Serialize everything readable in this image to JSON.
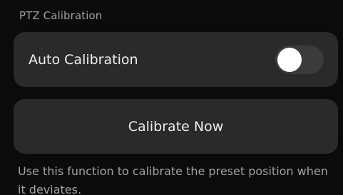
{
  "section": {
    "title": "PTZ Calibration"
  },
  "auto_calibration": {
    "label": "Auto Calibration",
    "enabled": false
  },
  "calibrate_now": {
    "label": "Calibrate Now"
  },
  "help": {
    "text": "Use this function to calibrate the preset position when it deviates."
  },
  "colors": {
    "background": "#0b0b0b",
    "card": "#2a2a2a",
    "toggle_track_off": "#3b3b3b",
    "toggle_knob": "#ffffff",
    "primary_text": "#ededed",
    "secondary_text": "#a3a3a3"
  }
}
